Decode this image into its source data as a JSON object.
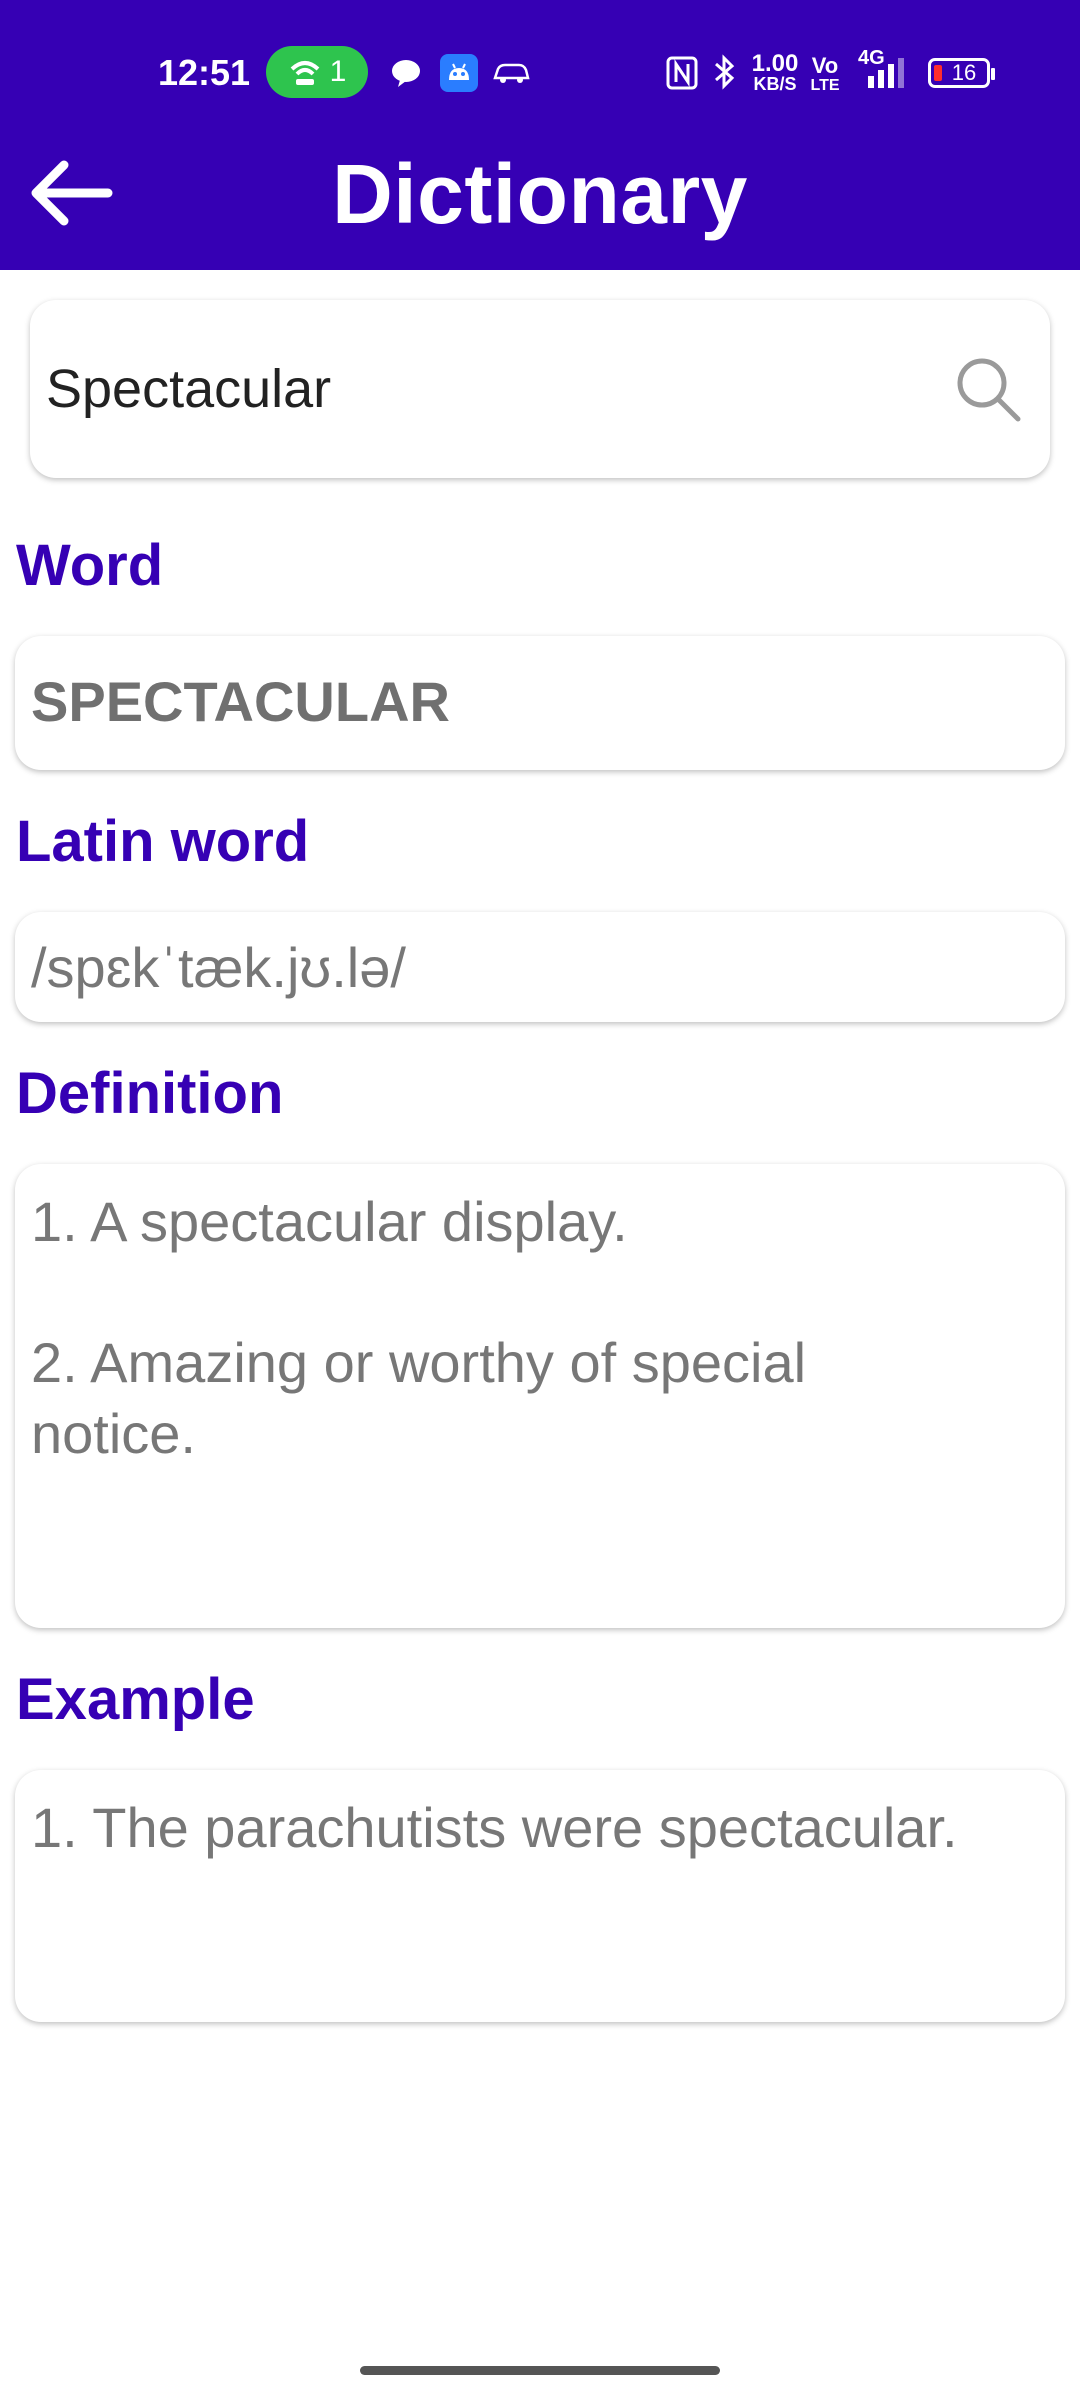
{
  "status_bar": {
    "time": "12:51",
    "hotspot_count": "1",
    "net_speed_value": "1.00",
    "net_speed_unit": "KB/S",
    "volte_top": "Vo",
    "volte_bottom": "LTE",
    "network": "4G",
    "battery": "16"
  },
  "app_bar": {
    "title": "Dictionary"
  },
  "search": {
    "value": "Spectacular"
  },
  "fields": {
    "word_label": "Word",
    "word_value": "SPECTACULAR",
    "latin_label": "Latin word",
    "latin_value": "/spɛkˈtæk.jʊ.lə/",
    "definition_label": "Definition",
    "definition_line1": "1. A spectacular display.",
    "definition_line2": "2. Amazing or worthy of special",
    "definition_line3": "notice.",
    "example_label": "Example",
    "example_line1": "1. The parachutists were spectacular."
  },
  "colors": {
    "primary": "#3600b4",
    "hotspot": "#2ec44e",
    "text_muted": "#777777"
  }
}
